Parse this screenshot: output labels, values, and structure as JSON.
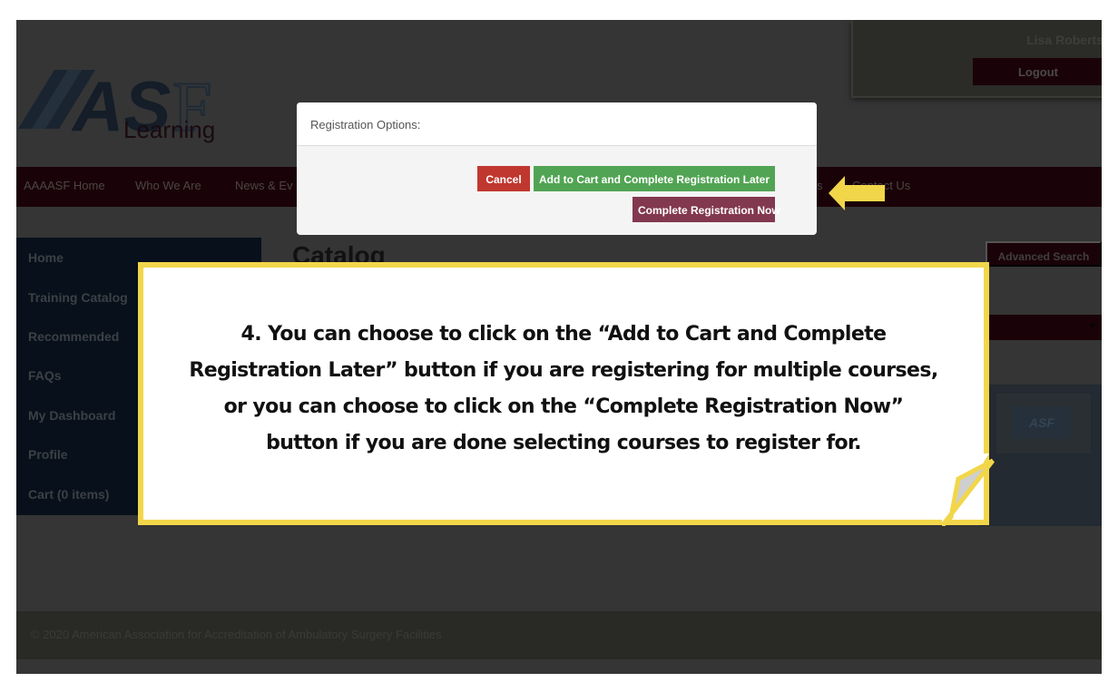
{
  "header": {
    "logo_text": "ASF",
    "logo_subtext": "Learning",
    "user_name": "Lisa Roberts",
    "logout_label": "Logout"
  },
  "topnav": {
    "items": [
      "AAAASF Home",
      "Who We Are",
      "News & Ev",
      "s",
      "Contact Us"
    ]
  },
  "sidebar": {
    "items": [
      "Home",
      "Training Catalog",
      "Recommended",
      "FAQs",
      "My Dashboard",
      "Profile",
      "Cart (0 items)"
    ]
  },
  "main": {
    "title": "Catalog",
    "advanced_search_label": "Advanced Search",
    "course_thumb_text": "ASF"
  },
  "modal": {
    "title": "Registration Options:",
    "cancel_label": "Cancel",
    "add_to_cart_label": "Add to Cart and Complete Registration Later",
    "complete_now_label": "Complete Registration Now"
  },
  "callout": {
    "lines": [
      "4.  You can choose to click on the “Add to Cart and Complete",
      "Registration Later” button if you are registering for multiple courses,",
      "or you can choose to click on the “Complete Registration Now”",
      "button if you are done selecting courses to register for."
    ]
  },
  "footer": {
    "copyright": "© 2020 American Association for Accreditation of Ambulatory Surgery Facilities"
  },
  "colors": {
    "overlay_bg": "#353535",
    "nav_maroon": "#1a0308",
    "sidebar_navy": "#08111b",
    "cancel_red": "#c0372f",
    "add_green": "#51a453",
    "now_maroon": "#82384f",
    "callout_yellow": "#f2d64a"
  }
}
